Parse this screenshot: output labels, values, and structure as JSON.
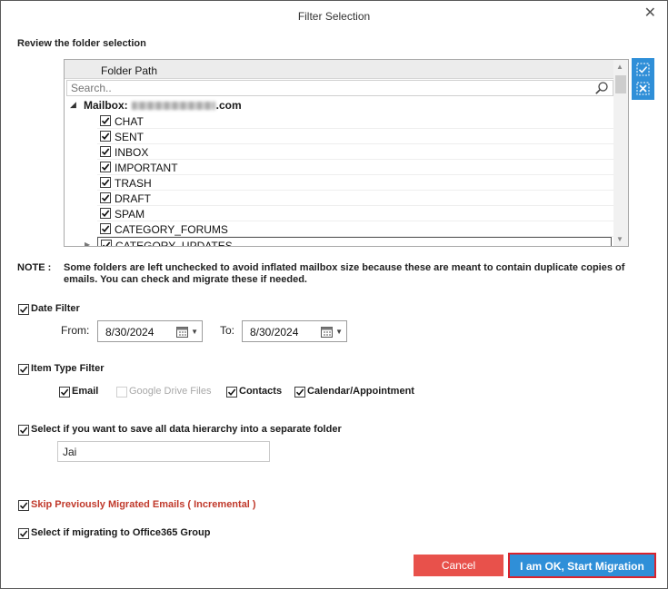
{
  "dialog": {
    "title": "Filter Selection",
    "close_glyph": "✕"
  },
  "folder_section": {
    "heading": "Review the folder selection",
    "column_header": "Folder Path",
    "search_placeholder": "Search..",
    "mailbox_prefix": "Mailbox:",
    "mailbox_suffix": ".com",
    "folders": [
      {
        "label": "CHAT",
        "checked": true
      },
      {
        "label": "SENT",
        "checked": true
      },
      {
        "label": "INBOX",
        "checked": true
      },
      {
        "label": "IMPORTANT",
        "checked": true
      },
      {
        "label": "TRASH",
        "checked": true
      },
      {
        "label": "DRAFT",
        "checked": true
      },
      {
        "label": "SPAM",
        "checked": true
      },
      {
        "label": "CATEGORY_FORUMS",
        "checked": true
      },
      {
        "label": "CATEGORY_UPDATES",
        "checked": true
      }
    ]
  },
  "note": {
    "label": "NOTE :",
    "text": "Some folders are left unchecked to avoid inflated mailbox size because these are meant to contain duplicate copies of emails. You can check and migrate these if needed."
  },
  "date_filter": {
    "label": "Date Filter",
    "checked": true,
    "from_label": "From:",
    "from_value": "8/30/2024",
    "to_label": "To:",
    "to_value": "8/30/2024"
  },
  "item_type_filter": {
    "label": "Item Type Filter",
    "checked": true,
    "email": "Email",
    "google_drive": "Google Drive Files",
    "contacts": "Contacts",
    "calendar": "Calendar/Appointment"
  },
  "hierarchy": {
    "label": "Select if you want to save all data hierarchy into a separate folder",
    "checked": true,
    "folder_name": "Jai"
  },
  "incremental": {
    "label": "Skip Previously Migrated Emails ( Incremental )",
    "checked": true
  },
  "office365_group": {
    "label": "Select if migrating to Office365 Group",
    "checked": true
  },
  "buttons": {
    "cancel": "Cancel",
    "start": "I am OK, Start Migration"
  },
  "colors": {
    "accent": "#2f8fd8",
    "cancel": "#e8514b",
    "highlight_border": "#d9232d",
    "incremental_text": "#c0392b"
  },
  "icons": [
    "close-icon",
    "search-icon",
    "check-all-icon",
    "uncheck-all-icon",
    "calendar-icon",
    "dropdown-arrow-icon",
    "expand-arrow-icon"
  ]
}
